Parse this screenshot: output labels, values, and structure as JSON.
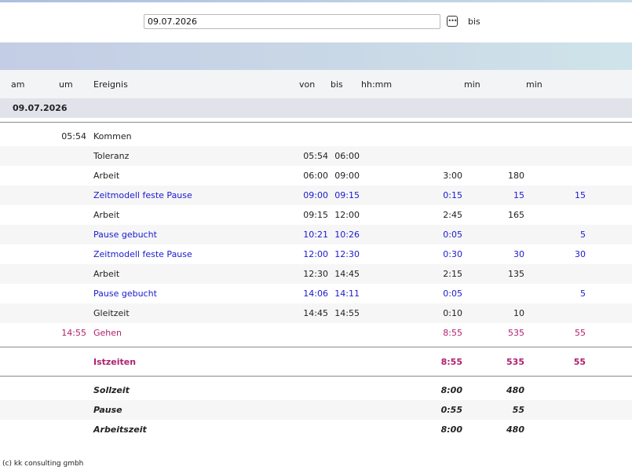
{
  "filter": {
    "date_value": "09.07.2026",
    "calendar_icon": "calendar-icon",
    "bis_label": "bis"
  },
  "columns": {
    "am": "am",
    "um": "um",
    "ereignis": "Ereignis",
    "von": "von",
    "bis": "bis",
    "hhmm": "hh:mm",
    "min1": "min",
    "min2": "min"
  },
  "day_label": "09.07.2026",
  "rows": [
    {
      "um": "05:54",
      "event": "Kommen",
      "von": "",
      "bis": "",
      "hhmm": "",
      "min1": "",
      "min2": "",
      "style": "normal"
    },
    {
      "um": "",
      "event": "Toleranz",
      "von": "05:54",
      "bis": "06:00",
      "hhmm": "",
      "min1": "",
      "min2": "",
      "style": "normal"
    },
    {
      "um": "",
      "event": "Arbeit",
      "von": "06:00",
      "bis": "09:00",
      "hhmm": "3:00",
      "min1": "180",
      "min2": "",
      "style": "normal"
    },
    {
      "um": "",
      "event": "Zeitmodell feste Pause",
      "von": "09:00",
      "bis": "09:15",
      "hhmm": "0:15",
      "min1": "15",
      "min2": "15",
      "style": "blue"
    },
    {
      "um": "",
      "event": "Arbeit",
      "von": "09:15",
      "bis": "12:00",
      "hhmm": "2:45",
      "min1": "165",
      "min2": "",
      "style": "normal"
    },
    {
      "um": "",
      "event": "Pause gebucht",
      "von": "10:21",
      "bis": "10:26",
      "hhmm": "0:05",
      "min1": "",
      "min2": "5",
      "style": "blue"
    },
    {
      "um": "",
      "event": "Zeitmodell feste Pause",
      "von": "12:00",
      "bis": "12:30",
      "hhmm": "0:30",
      "min1": "30",
      "min2": "30",
      "style": "blue"
    },
    {
      "um": "",
      "event": "Arbeit",
      "von": "12:30",
      "bis": "14:45",
      "hhmm": "2:15",
      "min1": "135",
      "min2": "",
      "style": "normal"
    },
    {
      "um": "",
      "event": "Pause gebucht",
      "von": "14:06",
      "bis": "14:11",
      "hhmm": "0:05",
      "min1": "",
      "min2": "5",
      "style": "blue"
    },
    {
      "um": "",
      "event": "Gleitzeit",
      "von": "14:45",
      "bis": "14:55",
      "hhmm": "0:10",
      "min1": "10",
      "min2": "",
      "style": "normal"
    },
    {
      "um": "14:55",
      "event": "Gehen",
      "von": "",
      "bis": "",
      "hhmm": "8:55",
      "min1": "535",
      "min2": "55",
      "style": "magenta"
    }
  ],
  "istzeiten": {
    "label": "Istzeiten",
    "hhmm": "8:55",
    "min1": "535",
    "min2": "55"
  },
  "summary": [
    {
      "label": "Sollzeit",
      "hhmm": "8:00",
      "min1": "480"
    },
    {
      "label": "Pause",
      "hhmm": "0:55",
      "min1": "55"
    },
    {
      "label": "Arbeitszeit",
      "hhmm": "8:00",
      "min1": "480"
    }
  ],
  "footer": "(c) kk consulting gmbh",
  "colors": {
    "blue": "#1a1ad0",
    "magenta": "#b0206e"
  }
}
